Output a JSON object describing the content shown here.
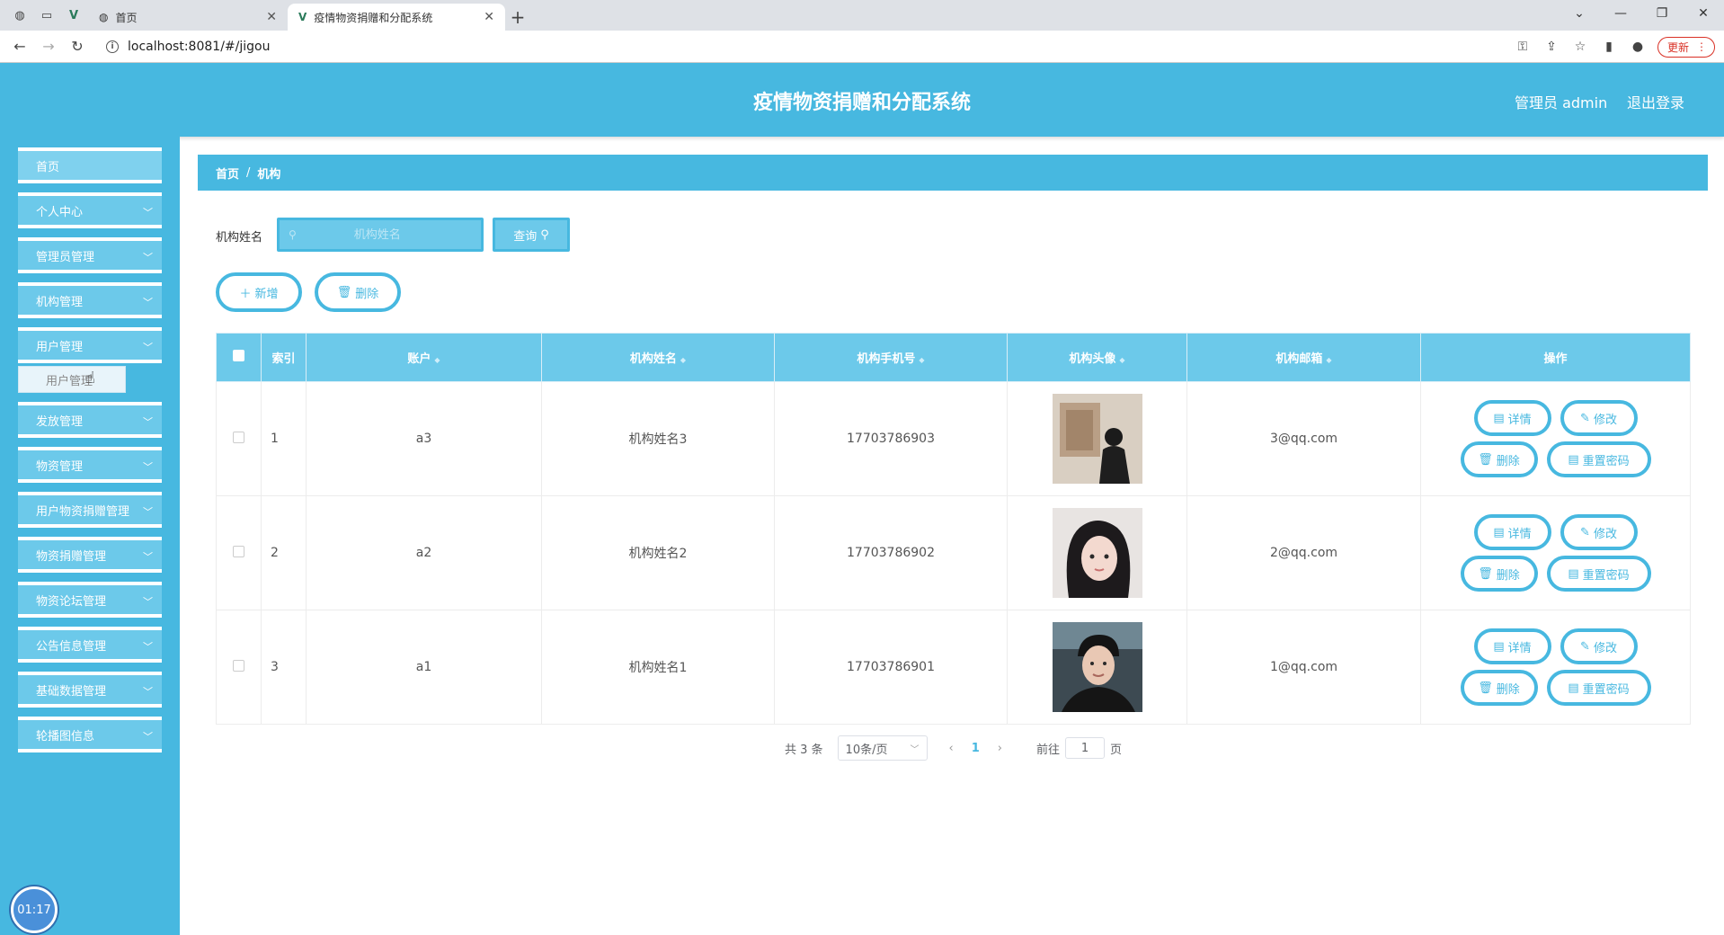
{
  "browser": {
    "tabs": [
      {
        "title": "首页",
        "active": false
      },
      {
        "title": "疫情物资捐赠和分配系统",
        "active": true
      }
    ],
    "url": "localhost:8081/#/jigou",
    "update_label": "更新"
  },
  "header": {
    "title": "疫情物资捐赠和分配系统",
    "user": "管理员 admin",
    "logout": "退出登录"
  },
  "sidebar": {
    "items": [
      {
        "label": "首页"
      },
      {
        "label": "个人中心"
      },
      {
        "label": "管理员管理"
      },
      {
        "label": "机构管理"
      },
      {
        "label": "用户管理"
      },
      {
        "label": "发放管理"
      },
      {
        "label": "物资管理"
      },
      {
        "label": "用户物资捐赠管理"
      },
      {
        "label": "物资捐赠管理"
      },
      {
        "label": "物资论坛管理"
      },
      {
        "label": "公告信息管理"
      },
      {
        "label": "基础数据管理"
      },
      {
        "label": "轮播图信息"
      }
    ],
    "submenu_label": "用户管理",
    "timer": "01:17"
  },
  "breadcrumb": {
    "home": "首页",
    "current": "机构"
  },
  "search": {
    "label": "机构姓名",
    "placeholder": "机构姓名",
    "button": "查询"
  },
  "toolbar": {
    "add": "新增",
    "delete": "删除"
  },
  "table": {
    "columns": [
      "索引",
      "账户",
      "机构姓名",
      "机构手机号",
      "机构头像",
      "机构邮箱",
      "操作"
    ],
    "rows": [
      {
        "index": "1",
        "account": "a3",
        "name": "机构姓名3",
        "phone": "17703786903",
        "email": "3@qq.com"
      },
      {
        "index": "2",
        "account": "a2",
        "name": "机构姓名2",
        "phone": "17703786902",
        "email": "2@qq.com"
      },
      {
        "index": "3",
        "account": "a1",
        "name": "机构姓名1",
        "phone": "17703786901",
        "email": "1@qq.com"
      }
    ],
    "actions": {
      "detail": "详情",
      "edit": "修改",
      "delete": "删除",
      "reset": "重置密码"
    }
  },
  "pager": {
    "total": "共 3 条",
    "size": "10条/页",
    "page": "1",
    "goto_prefix": "前往",
    "goto_value": "1",
    "goto_suffix": "页"
  },
  "colors": {
    "primary": "#47b8e0",
    "light": "#6cc9ea"
  }
}
